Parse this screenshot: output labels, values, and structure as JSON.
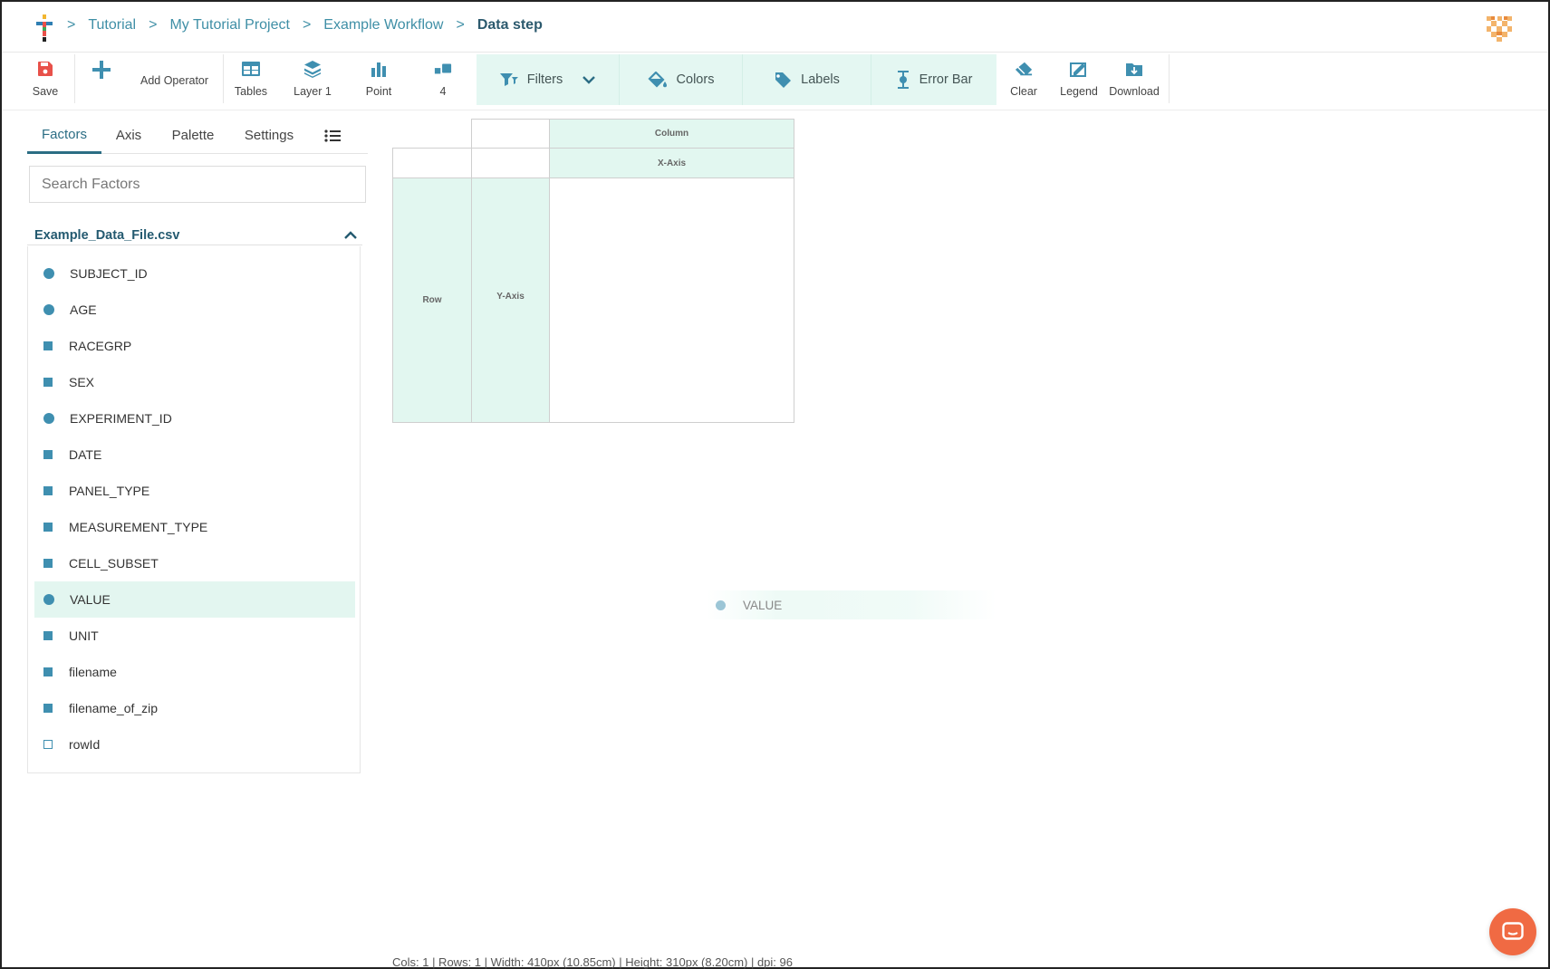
{
  "breadcrumb": {
    "items": [
      "Tutorial",
      "My Tutorial Project",
      "Example Workflow",
      "Data step"
    ],
    "separator": ">"
  },
  "toolbar": {
    "save": "Save",
    "add_operator": "Add Operator",
    "tables": "Tables",
    "layer": "Layer 1",
    "point": "Point",
    "layer_count": "4",
    "filters": "Filters",
    "colors": "Colors",
    "labels": "Labels",
    "error_bar": "Error Bar",
    "clear": "Clear",
    "legend": "Legend",
    "download": "Download"
  },
  "side_panel": {
    "tabs": [
      "Factors",
      "Axis",
      "Palette",
      "Settings"
    ],
    "active_tab": "Factors",
    "search": {
      "placeholder": "Search Factors",
      "value": ""
    },
    "file_name": "Example_Data_File.csv",
    "factors": [
      {
        "name": "SUBJECT_ID",
        "kind": "numeric"
      },
      {
        "name": "AGE",
        "kind": "numeric"
      },
      {
        "name": "RACEGRP",
        "kind": "text"
      },
      {
        "name": "SEX",
        "kind": "text"
      },
      {
        "name": "EXPERIMENT_ID",
        "kind": "numeric"
      },
      {
        "name": "DATE",
        "kind": "text"
      },
      {
        "name": "PANEL_TYPE",
        "kind": "text"
      },
      {
        "name": "MEASUREMENT_TYPE",
        "kind": "text"
      },
      {
        "name": "CELL_SUBSET",
        "kind": "text"
      },
      {
        "name": "VALUE",
        "kind": "numeric",
        "selected": true
      },
      {
        "name": "UNIT",
        "kind": "text"
      },
      {
        "name": "filename",
        "kind": "text"
      },
      {
        "name": "filename_of_zip",
        "kind": "text"
      },
      {
        "name": "rowId",
        "kind": "index"
      }
    ]
  },
  "layout_grid": {
    "column": "Column",
    "x_axis": "X-Axis",
    "row": "Row",
    "y_axis": "Y-Axis"
  },
  "drag_ghost": "VALUE",
  "status_bar": "Cols: 1 | Rows: 1 | Width: 410px (10.85cm) | Height: 310px (8.20cm) | dpi: 96",
  "colors": {
    "accent": "#3f8fb0",
    "highlight": "#e2f7f0",
    "save_icon": "#e8514a",
    "chat_button": "#f06a43"
  }
}
